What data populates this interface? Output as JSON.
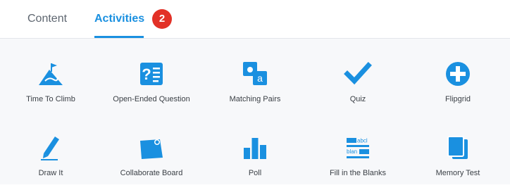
{
  "tabs": {
    "content_label": "Content",
    "activities_label": "Activities",
    "activities_badge": "2"
  },
  "colors": {
    "accent": "#1a90e0",
    "icon_blue": "#1a90e0",
    "badge_red": "#e23127"
  },
  "activities": [
    {
      "label": "Time To Climb",
      "icon": "climb-mountain-icon"
    },
    {
      "label": "Open-Ended Question",
      "icon": "question-document-icon"
    },
    {
      "label": "Matching Pairs",
      "icon": "matching-pairs-icon"
    },
    {
      "label": "Quiz",
      "icon": "checkmark-icon"
    },
    {
      "label": "Flipgrid",
      "icon": "flipgrid-plus-icon"
    },
    {
      "label": "Draw It",
      "icon": "pencil-icon"
    },
    {
      "label": "Collaborate Board",
      "icon": "board-pin-icon"
    },
    {
      "label": "Poll",
      "icon": "bar-chart-icon"
    },
    {
      "label": "Fill in the Blanks",
      "icon": "fill-blanks-icon",
      "icon_text_1": "abcl",
      "icon_text_2": "blan"
    },
    {
      "label": "Memory Test",
      "icon": "memory-cards-icon"
    }
  ]
}
